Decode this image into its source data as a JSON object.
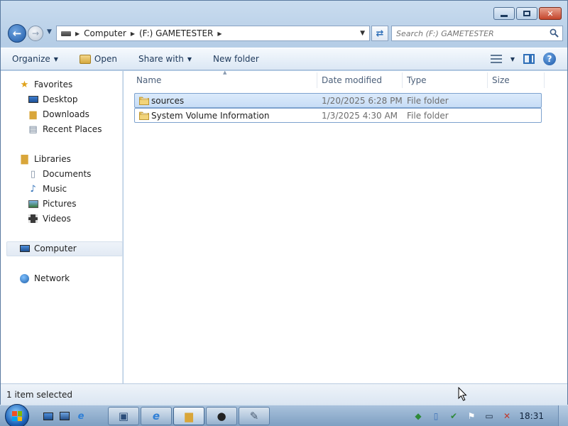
{
  "window": {
    "caption": {
      "minimize": "",
      "maximize": "",
      "close": "✕"
    }
  },
  "nav": {
    "crumbs": [
      "Computer",
      "(F:) GAMETESTER"
    ],
    "search_placeholder": "Search (F:) GAMETESTER"
  },
  "toolbar": {
    "organize": "Organize",
    "open": "Open",
    "share_with": "Share with",
    "new_folder": "New folder"
  },
  "navpane": {
    "favorites": "Favorites",
    "desktop": "Desktop",
    "downloads": "Downloads",
    "recent_places": "Recent Places",
    "libraries": "Libraries",
    "documents": "Documents",
    "music": "Music",
    "pictures": "Pictures",
    "videos": "Videos",
    "computer": "Computer",
    "network": "Network"
  },
  "columns": {
    "name": "Name",
    "date_modified": "Date modified",
    "type": "Type",
    "size": "Size"
  },
  "files": [
    {
      "name": "sources",
      "date": "1/20/2025 6:28 PM",
      "type": "File folder",
      "selected": true
    },
    {
      "name": "System Volume Information",
      "date": "1/3/2025 4:30 AM",
      "type": "File folder",
      "selected": false
    }
  ],
  "status": {
    "text": "1 item selected"
  },
  "taskbar": {
    "clock": "18:31"
  },
  "colors": {
    "accent": "#2f6fb8",
    "selection": "#c7ddf6",
    "selection_border": "#7da2ce"
  }
}
